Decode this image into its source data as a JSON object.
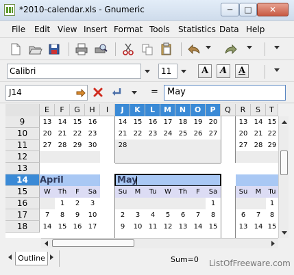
{
  "window": {
    "title": "*2010-calendar.xls - Gnumeric",
    "minimize": "─",
    "maximize": "□",
    "close": "✕"
  },
  "menu": [
    "File",
    "Edit",
    "View",
    "Insert",
    "Format",
    "Tools",
    "Statistics",
    "Data",
    "Help"
  ],
  "format": {
    "font_name": "Calibri",
    "font_size": "11",
    "bold_label": "A",
    "italic_label": "A",
    "underline_label": "A"
  },
  "editbar": {
    "cell_ref": "J14",
    "equals_label": "=",
    "formula": "May"
  },
  "grid": {
    "columns": [
      "E",
      "F",
      "G",
      "H",
      "I",
      "J",
      "K",
      "L",
      "M",
      "N",
      "O",
      "P",
      "Q",
      "R",
      "S",
      "T"
    ],
    "rows": [
      "9",
      "10",
      "11",
      "12",
      "13",
      "14",
      "15",
      "16",
      "17",
      "18"
    ],
    "left_block": {
      "rows": [
        [
          "13",
          "14",
          "15",
          "16"
        ],
        [
          "20",
          "21",
          "22",
          "23"
        ],
        [
          "27",
          "28",
          "29",
          "30"
        ]
      ]
    },
    "mid_block": {
      "rows": [
        [
          "14",
          "15",
          "16",
          "17",
          "18",
          "19",
          "20"
        ],
        [
          "21",
          "22",
          "23",
          "24",
          "25",
          "26",
          "27"
        ],
        [
          "28",
          "",
          "",
          "",
          "",
          "",
          ""
        ]
      ]
    },
    "right_block": {
      "rows": [
        [
          "13",
          "14",
          "15"
        ],
        [
          "20",
          "21",
          "22"
        ],
        [
          "27",
          "28",
          "29"
        ]
      ]
    },
    "april": {
      "title": "April",
      "days": [
        "W",
        "Th",
        "F",
        "Sa"
      ],
      "weeks": [
        [
          "",
          "1",
          "2",
          "3"
        ],
        [
          "7",
          "8",
          "9",
          "10"
        ],
        [
          "14",
          "15",
          "16",
          "17"
        ]
      ]
    },
    "may": {
      "title": "May",
      "days": [
        "Su",
        "M",
        "Tu",
        "W",
        "Th",
        "F",
        "Sa"
      ],
      "weeks": [
        [
          "",
          "",
          "",
          "",
          "",
          "",
          "1"
        ],
        [
          "2",
          "3",
          "4",
          "5",
          "6",
          "7",
          "8"
        ],
        [
          "9",
          "10",
          "11",
          "12",
          "13",
          "14",
          "15"
        ]
      ]
    },
    "june": {
      "days": [
        "Su",
        "M",
        "Tu"
      ],
      "weeks": [
        [
          "",
          "",
          "1"
        ],
        [
          "6",
          "7",
          "8"
        ],
        [
          "13",
          "14",
          "15"
        ]
      ]
    }
  },
  "bottom": {
    "sheet_tab": "Outline",
    "status": "Sum=0",
    "watermark": "ListOfFreeware.com"
  }
}
